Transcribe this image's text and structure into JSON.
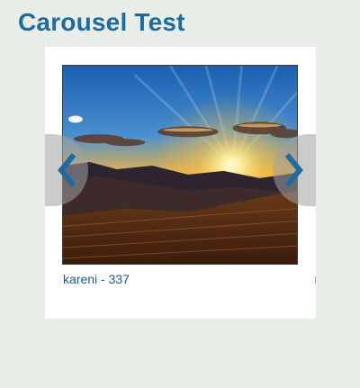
{
  "page": {
    "title": "Carousel Test"
  },
  "carousel": {
    "slides": [
      {
        "image": "sunset-landscape-image",
        "caption": "kareni - 337"
      }
    ],
    "current_index": 0,
    "prev_icon": "chevron-left-icon",
    "next_icon": "chevron-right-icon"
  },
  "colors": {
    "title": "#1e6ba0",
    "caption": "#1e5a8a",
    "nav_arrow": "#1e6ba0",
    "background": "#e8ede8",
    "card": "#ffffff"
  }
}
